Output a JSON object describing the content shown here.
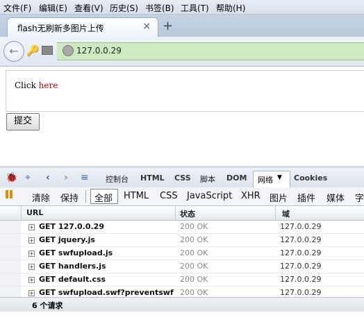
{
  "menu": [
    "文件(F)",
    "编辑(E)",
    "查看(V)",
    "历史(S)",
    "书签(B)",
    "工具(T)",
    "帮助(H)"
  ],
  "tab": {
    "title": "flash无刷新多图片上传",
    "close": "×",
    "new_tab": "+"
  },
  "nav": {
    "url": "127.0.0.29"
  },
  "page": {
    "click_text": "Click ",
    "link_text": "here",
    "submit_label": "提交"
  },
  "firebug": {
    "tabs": [
      "控制台",
      "HTML",
      "CSS",
      "脚本",
      "DOM"
    ],
    "active_tab": "网络",
    "cookies_tab": "Cookies",
    "filter": {
      "clear": "清除",
      "persist": "保持",
      "types": [
        "全部",
        "HTML",
        "CSS",
        "JavaScript",
        "XHR",
        "图片",
        "插件",
        "媒体",
        "字"
      ]
    },
    "columns": {
      "url": "URL",
      "status": "状态",
      "domain": "域"
    },
    "requests": [
      {
        "url": "GET 127.0.0.29",
        "status": "200 OK",
        "domain": "127.0.0.29"
      },
      {
        "url": "GET jquery.js",
        "status": "200 OK",
        "domain": "127.0.0.29"
      },
      {
        "url": "GET swfupload.js",
        "status": "200 OK",
        "domain": "127.0.0.29"
      },
      {
        "url": "GET handlers.js",
        "status": "200 OK",
        "domain": "127.0.0.29"
      },
      {
        "url": "GET default.css",
        "status": "200 OK",
        "domain": "127.0.0.29"
      },
      {
        "url": "GET swfupload.swf?preventswfca",
        "status": "200 OK",
        "domain": "127.0.0.29"
      }
    ],
    "summary": "6 个请求"
  }
}
